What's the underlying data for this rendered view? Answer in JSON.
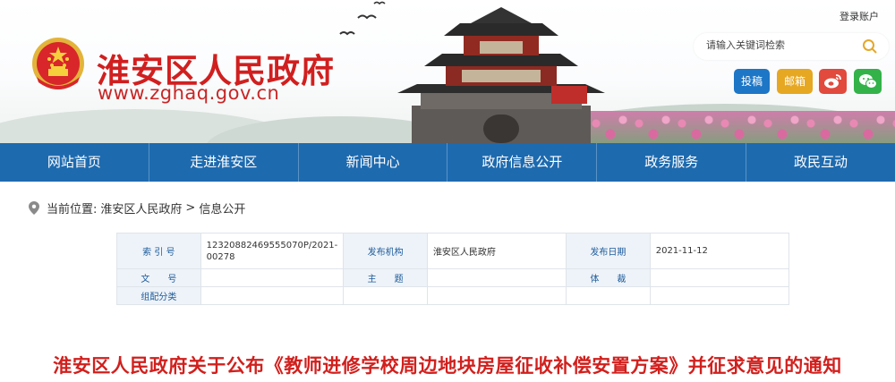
{
  "header": {
    "title": "淮安区人民政府",
    "url": "www.zghaq.gov.cn",
    "login": "登录账户",
    "search_placeholder": "请输入关键词检索",
    "buttons": {
      "tougao": "投稿",
      "youxiang": "邮箱"
    },
    "icons": [
      "national-emblem-icon",
      "search-icon",
      "weibo-icon",
      "wechat-icon"
    ]
  },
  "nav": [
    "网站首页",
    "走进淮安区",
    "新闻中心",
    "政府信息公开",
    "政务服务",
    "政民互动"
  ],
  "breadcrumb": {
    "label": "当前位置:",
    "items": [
      "淮安区人民政府",
      ">",
      "信息公开"
    ]
  },
  "info": {
    "suoyin_label": "索 引 号",
    "suoyin_value": "12320882469555070P/2021-00278",
    "jigou_label": "发布机构",
    "jigou_value": "淮安区人民政府",
    "riqi_label": "发布日期",
    "riqi_value": "2021-11-12",
    "wenhao_label": "文　　号",
    "wenhao_value": "",
    "zhuti_label": "主　　题",
    "zhuti_value": "",
    "ticai_label": "体　　裁",
    "ticai_value": "",
    "zupei_label": "组配分类",
    "zupei_value": ""
  },
  "article": {
    "title": "淮安区人民政府关于公布《教师进修学校周边地块房屋征收补偿安置方案》并征求意见的通知"
  },
  "colors": {
    "nav": "#1d6aaf",
    "title_red": "#d11f1f",
    "label_blue": "#1d5b9a"
  }
}
